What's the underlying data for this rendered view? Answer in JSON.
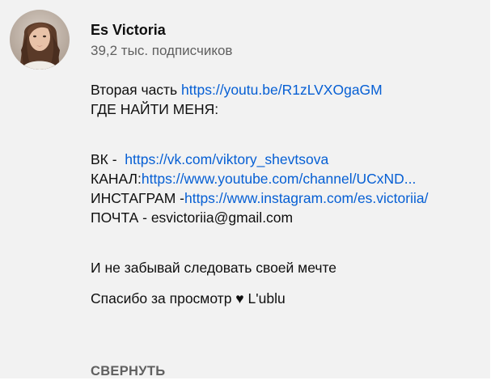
{
  "channel": {
    "name": "Es Victoria",
    "subscribers": "39,2 тыс. подписчиков"
  },
  "description": {
    "part2_label": "Вторая часть ",
    "part2_link": "https://youtu.be/R1zLVXOgaGM",
    "where_heading": "ГДЕ НАЙТИ МЕНЯ:",
    "vk_label": "ВК -  ",
    "vk_link": "https://vk.com/viktory_shevtsova",
    "channel_label": "КАНАЛ:",
    "channel_link": "https://www.youtube.com/channel/UCxND...",
    "instagram_label": "ИНСТАГРАМ -",
    "instagram_link": "https://www.instagram.com/es.victoriia/",
    "mail_label": "ПОЧТА - ",
    "mail_value": "esvictoriia@gmail.com",
    "dream_line": "И не забывай следовать своей мечте",
    "thanks_line": "Спасибо за просмотр ♥ L'ublu"
  },
  "actions": {
    "collapse_label": "СВЕРНУТЬ"
  },
  "colors": {
    "link": "#065fd4",
    "secondary_text": "#606060",
    "background": "#f2f2f2"
  }
}
